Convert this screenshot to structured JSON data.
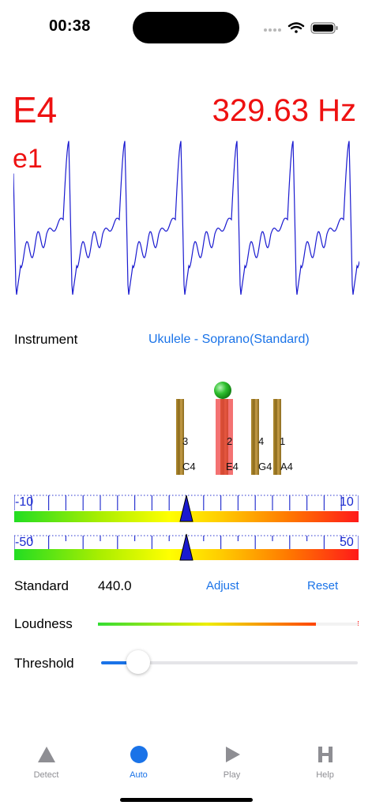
{
  "status": {
    "time": "00:38"
  },
  "readout": {
    "note": "E4",
    "frequency": "329.63",
    "unit": "Hz",
    "helmholtz": "e1"
  },
  "instrument": {
    "label": "Instrument",
    "value": "Ukulele - Soprano(Standard)"
  },
  "strings": [
    {
      "number": "3",
      "note": "C4"
    },
    {
      "number": "2",
      "note": "E4"
    },
    {
      "number": "4",
      "note": "G4"
    },
    {
      "number": "1",
      "note": "A4"
    }
  ],
  "meter_fine": {
    "min_label": "-10",
    "max_label": "10"
  },
  "meter_coarse": {
    "min_label": "-50",
    "max_label": "50"
  },
  "standard": {
    "label": "Standard",
    "value": "440.0",
    "adjust": "Adjust",
    "reset": "Reset"
  },
  "loudness": {
    "label": "Loudness",
    "level": 0.88
  },
  "threshold": {
    "label": "Threshold",
    "level": 0.1
  },
  "tabs": [
    {
      "label": "Detect",
      "icon": "triangle-icon",
      "active": false
    },
    {
      "label": "Auto",
      "icon": "circle-icon",
      "active": true
    },
    {
      "label": "Play",
      "icon": "play-icon",
      "active": false
    },
    {
      "label": "Help",
      "icon": "help-h-icon",
      "active": false
    }
  ],
  "colors": {
    "accent": "#1a73e8",
    "note_red": "#ee1111",
    "wave_blue": "#1a1ad0"
  }
}
